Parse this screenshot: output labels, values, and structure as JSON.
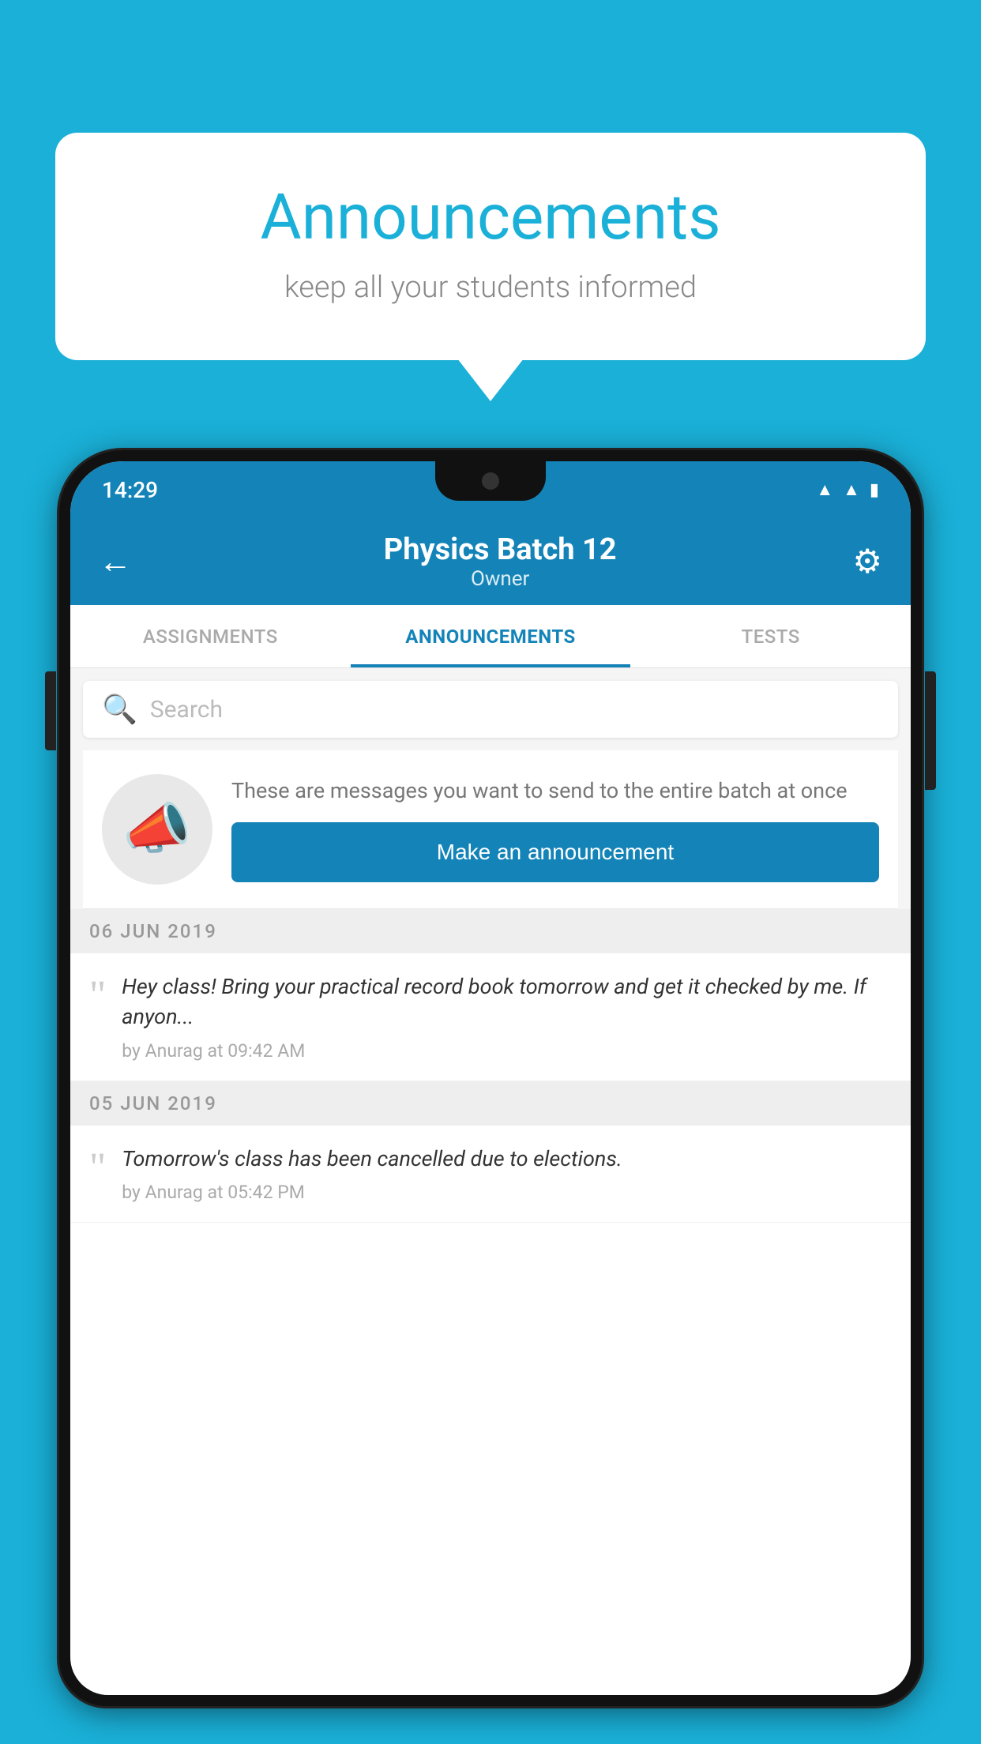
{
  "page": {
    "background_color": "#1ab0d8"
  },
  "speech_bubble": {
    "title": "Announcements",
    "subtitle": "keep all your students informed"
  },
  "status_bar": {
    "time": "14:29",
    "wifi": "wifi",
    "signal": "signal",
    "battery": "battery"
  },
  "app_bar": {
    "back_label": "←",
    "title": "Physics Batch 12",
    "subtitle": "Owner",
    "settings_icon": "⚙"
  },
  "tabs": [
    {
      "id": "assignments",
      "label": "ASSIGNMENTS",
      "active": false
    },
    {
      "id": "announcements",
      "label": "ANNOUNCEMENTS",
      "active": true
    },
    {
      "id": "tests",
      "label": "TESTS",
      "active": false
    }
  ],
  "search": {
    "placeholder": "Search"
  },
  "empty_state": {
    "description": "These are messages you want to send to the entire batch at once",
    "button_label": "Make an announcement"
  },
  "announcements": [
    {
      "date": "06  JUN  2019",
      "text": "Hey class! Bring your practical record book tomorrow and get it checked by me. If anyon...",
      "meta": "by Anurag at 09:42 AM"
    },
    {
      "date": "05  JUN  2019",
      "text": "Tomorrow's class has been cancelled due to elections.",
      "meta": "by Anurag at 05:42 PM"
    }
  ]
}
